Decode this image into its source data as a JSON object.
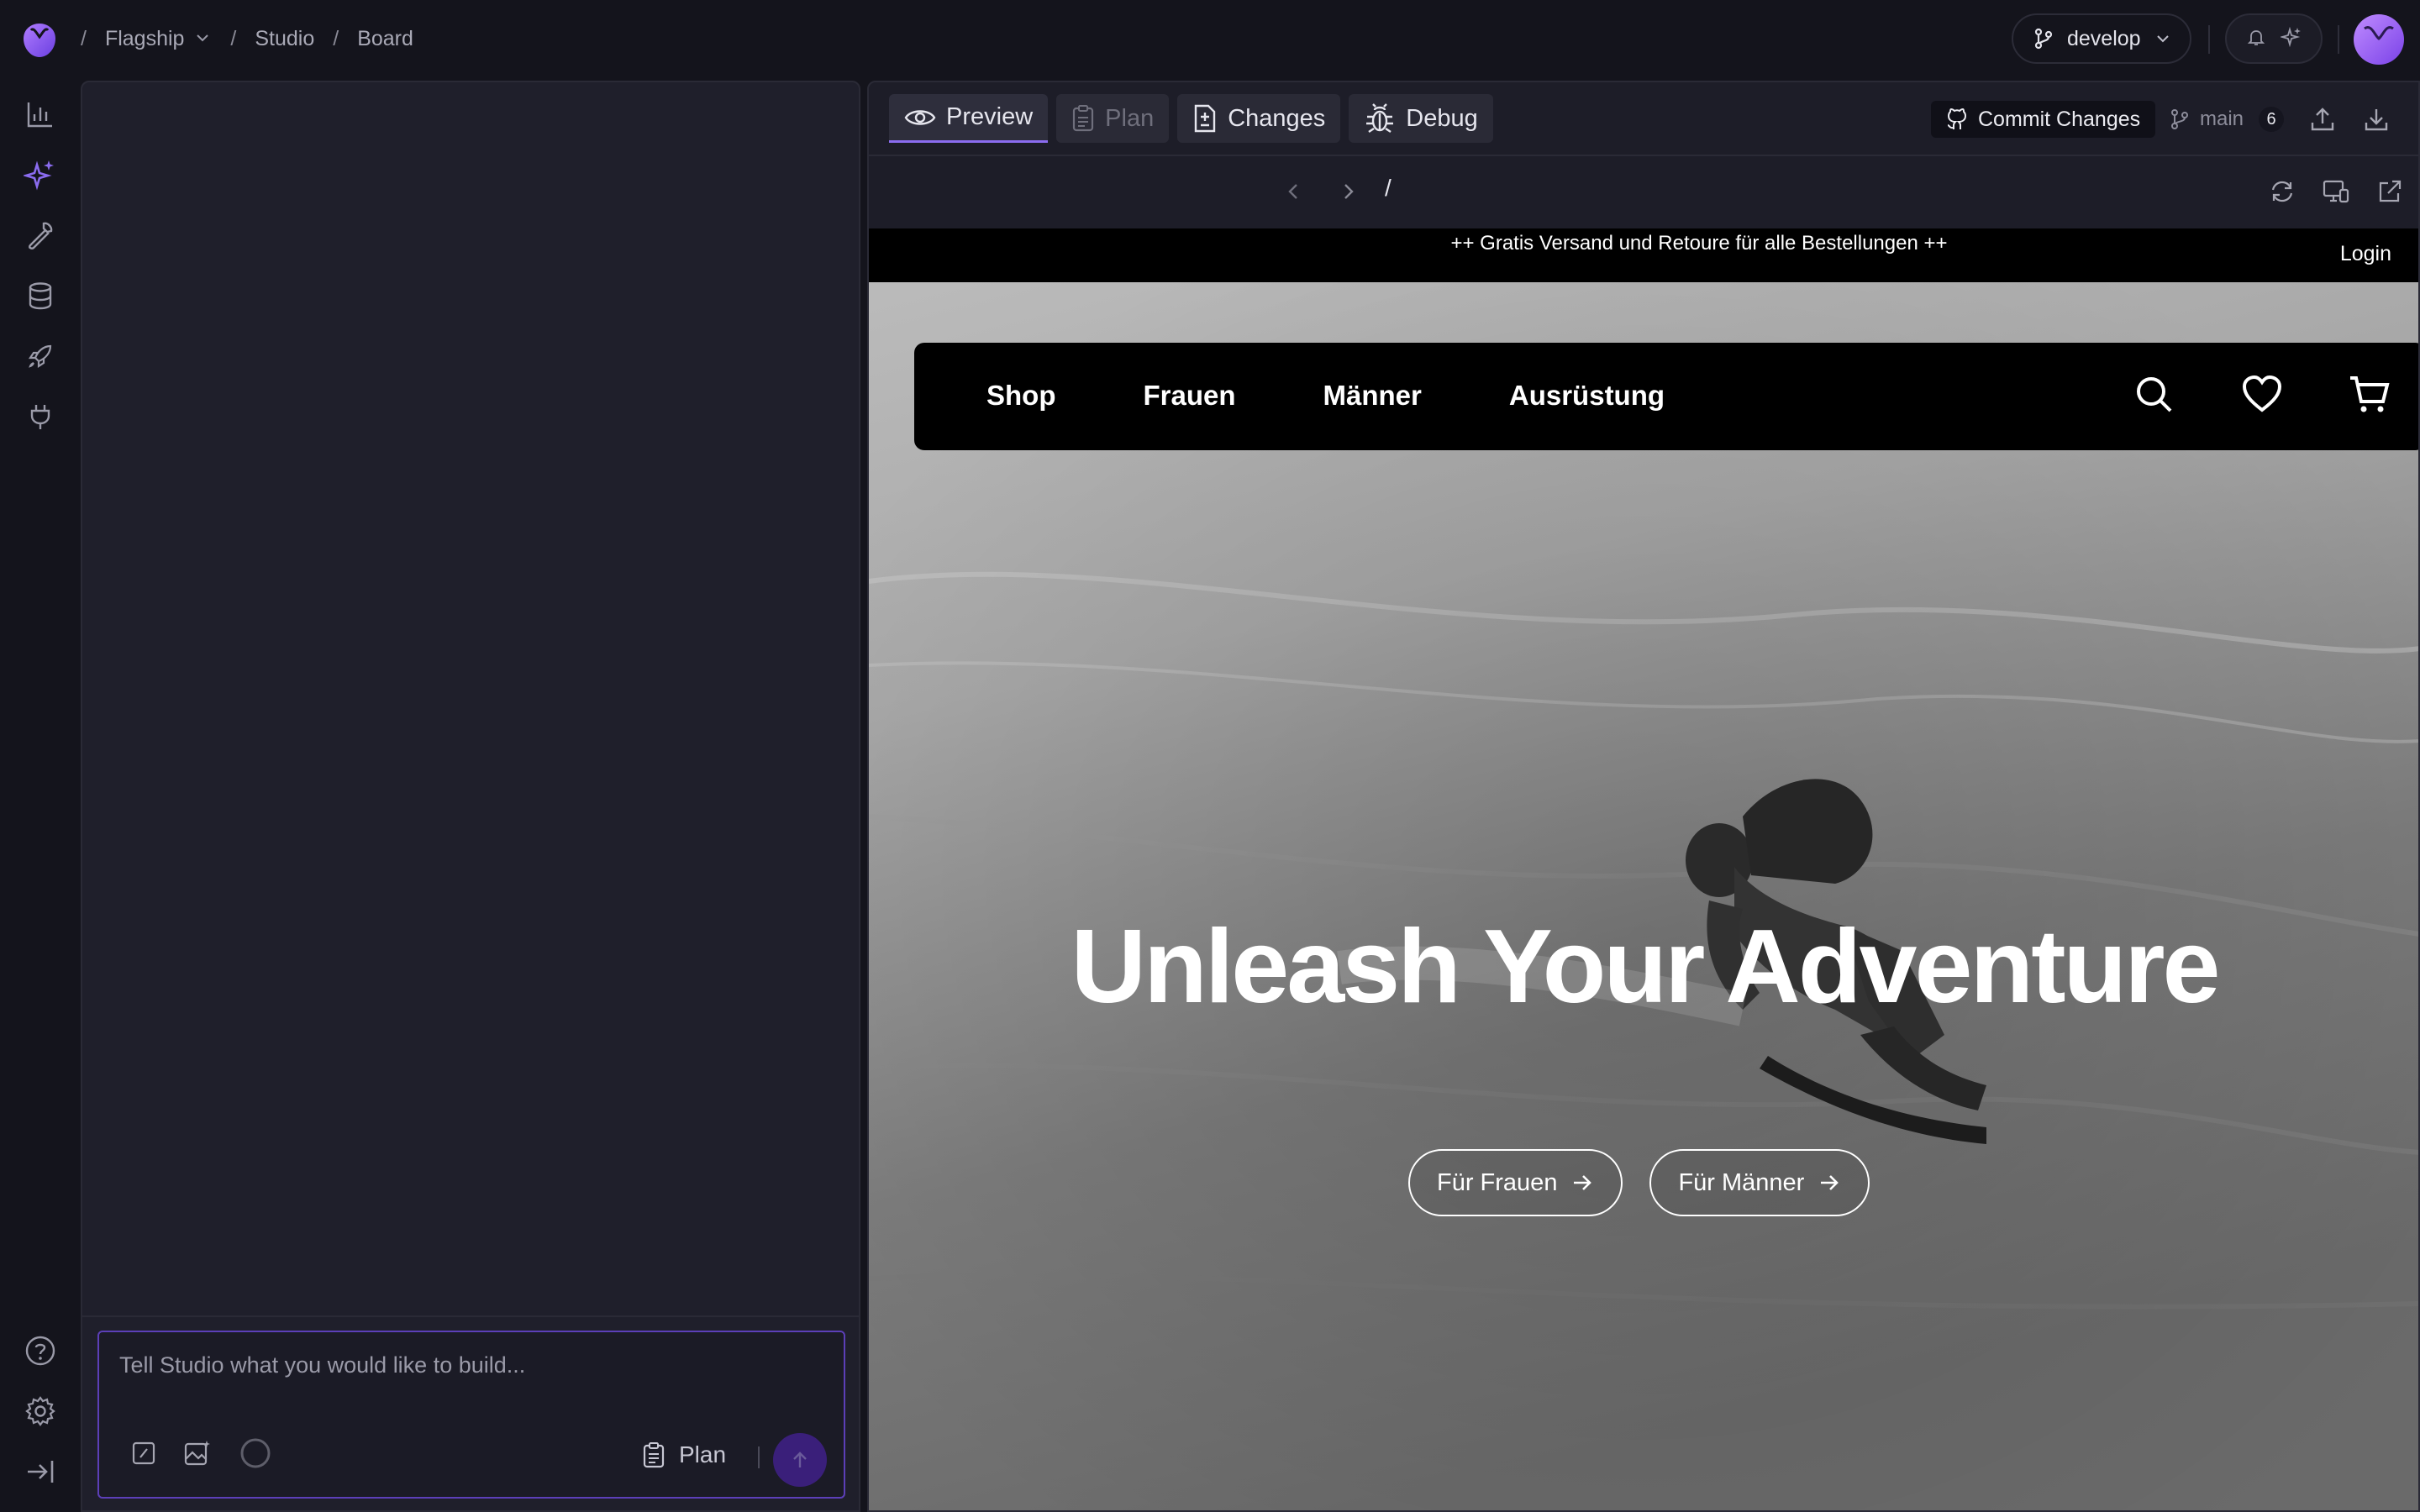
{
  "breadcrumb": {
    "project": "Flagship",
    "section": "Studio",
    "page": "Board"
  },
  "branch": {
    "current": "develop"
  },
  "sidebar_icons": [
    "analytics-icon",
    "ai-sparkle-icon",
    "wrench-icon",
    "database-icon",
    "rocket-icon",
    "plug-icon",
    "help-icon",
    "settings-icon",
    "collapse-sidebar-icon"
  ],
  "composer": {
    "placeholder": "Tell Studio what you would like to build...",
    "plan_label": "Plan"
  },
  "tabs": {
    "preview": "Preview",
    "plan": "Plan",
    "changes": "Changes",
    "debug": "Debug"
  },
  "toolbar": {
    "commit_label": "Commit Changes",
    "branch": "main",
    "change_count": "6"
  },
  "browser": {
    "path": "/"
  },
  "site": {
    "promo": "++ Gratis Versand und Retoure für alle Bestellungen ++",
    "login": "Login",
    "nav": [
      "Shop",
      "Frauen",
      "Männer",
      "Ausrüstung"
    ],
    "hero_title": "Unleash Your Adventure",
    "cta_women": "Für Frauen",
    "cta_men": "Für Männer"
  },
  "colors": {
    "accent": "#8b6cf0",
    "composer_border": "#5c3fb8",
    "send_button": "#3a1f7a",
    "app_bg": "#14141c",
    "panel_bg": "#1f1f2b"
  }
}
